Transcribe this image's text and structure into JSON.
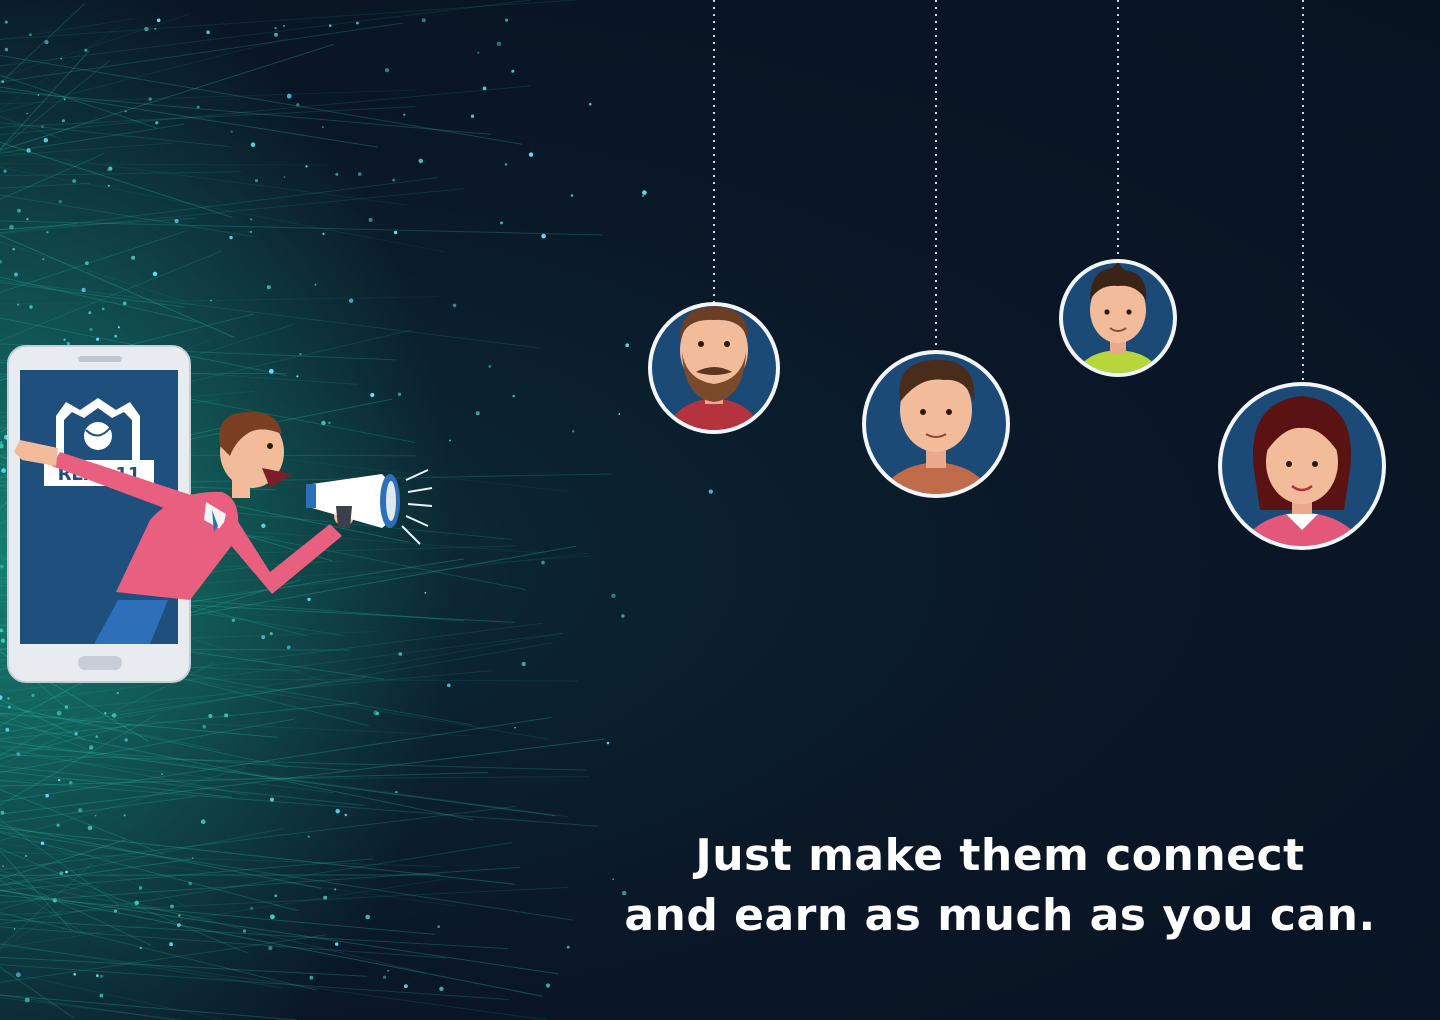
{
  "caption": {
    "line1": "Just make them connect",
    "line2": "and earn as much as you can."
  },
  "phone": {
    "logo_text": "REAL 11"
  },
  "colors": {
    "background": "#0b1626",
    "accent_teal": "#1fb59a",
    "avatar_bg": "#1c4a76",
    "phone_screen": "#1f4f7c",
    "shirt_pink": "#ea5f80"
  },
  "avatars": [
    {
      "icon": "bearded-man-avatar-icon"
    },
    {
      "icon": "young-man-avatar-icon"
    },
    {
      "icon": "boy-avatar-icon"
    },
    {
      "icon": "woman-avatar-icon"
    }
  ]
}
